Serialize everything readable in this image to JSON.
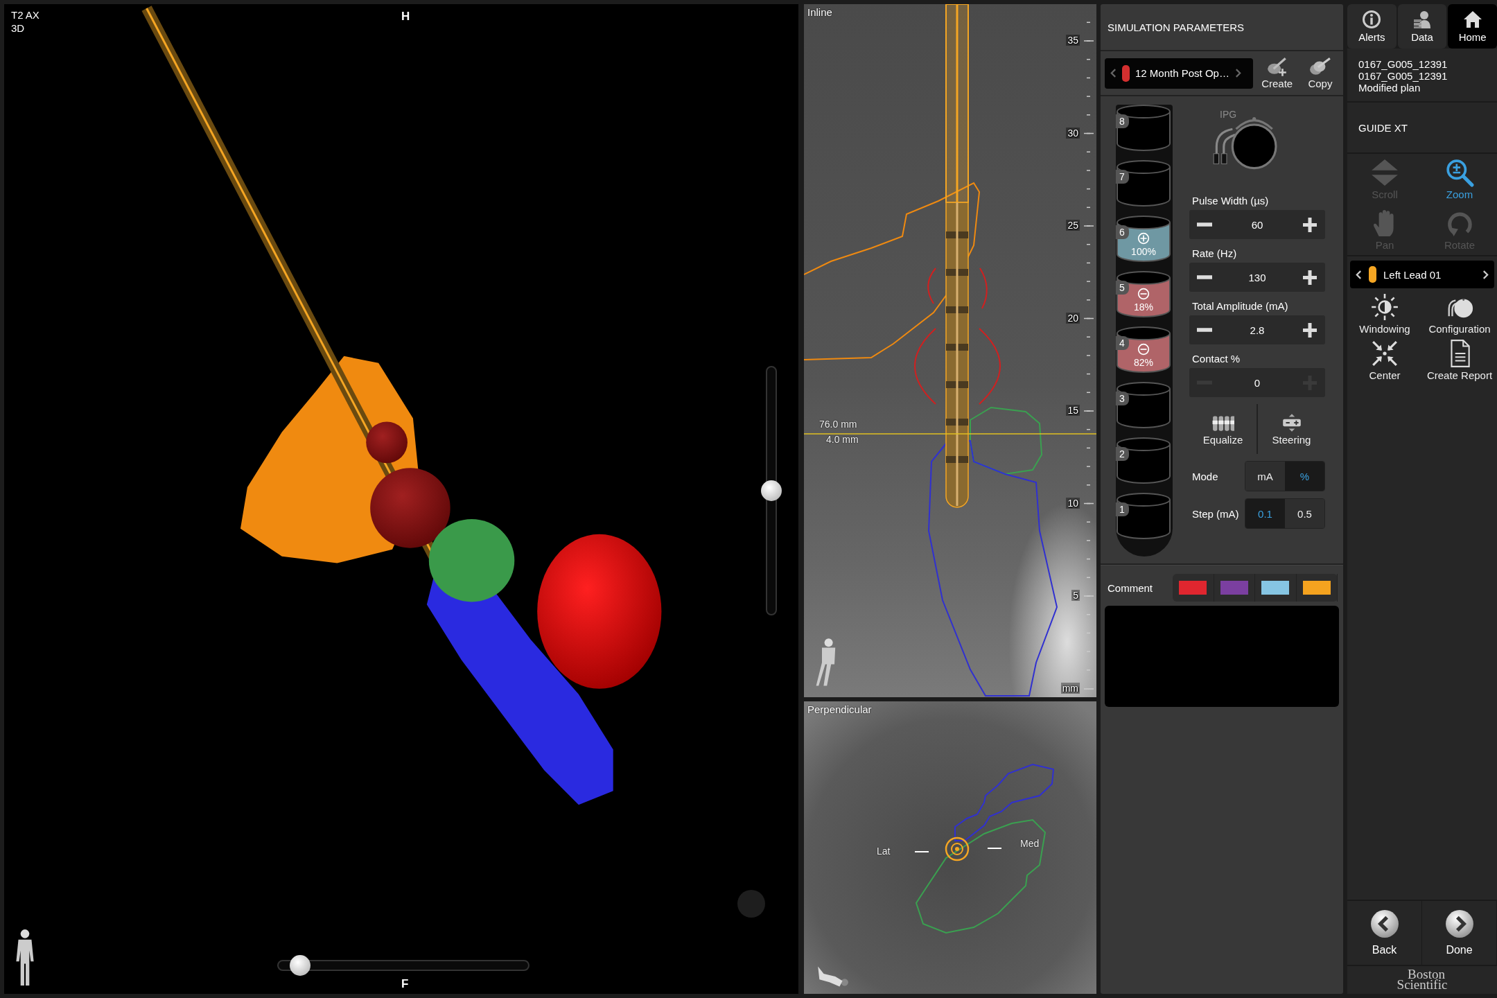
{
  "view_3d": {
    "series": "T2 AX",
    "mode": "3D",
    "top_marker": "H",
    "bottom_marker": "F",
    "vertical_slider": {
      "level": 0.5
    },
    "horizontal_slider": {
      "level": 0.08
    }
  },
  "inline_view": {
    "title": "Inline",
    "measurements": [
      "76.0 mm",
      "4.0 mm"
    ],
    "ruler": {
      "labels": [
        "35",
        "30",
        "25",
        "20",
        "15",
        "10",
        "5"
      ],
      "unit": "mm"
    }
  },
  "perpendicular_view": {
    "title": "Perpendicular",
    "left_label": "Lat",
    "right_label": "Med"
  },
  "simulation": {
    "title": "SIMULATION PARAMETERS",
    "program": {
      "name": "12 Month Post Op…",
      "color": "#d32f2f"
    },
    "actions": [
      {
        "label": "Create",
        "kind": "create"
      },
      {
        "label": "Copy",
        "kind": "copy"
      }
    ],
    "ipg_label": "IPG",
    "contacts": [
      {
        "number": "8",
        "kind": "off"
      },
      {
        "number": "7",
        "kind": "off"
      },
      {
        "number": "6",
        "kind": "anode",
        "percent": "100%"
      },
      {
        "number": "5",
        "kind": "cathode",
        "percent": "18%"
      },
      {
        "number": "4",
        "kind": "cathode",
        "percent": "82%"
      },
      {
        "number": "3",
        "kind": "off"
      },
      {
        "number": "2",
        "kind": "off"
      },
      {
        "number": "1",
        "kind": "off"
      }
    ],
    "parameters": [
      {
        "label": "Pulse Width (µs)",
        "value": "60",
        "disabled": false
      },
      {
        "label": "Rate (Hz)",
        "value": "130",
        "disabled": false
      },
      {
        "label": "Total Amplitude (mA)",
        "value": "2.8",
        "disabled": false
      },
      {
        "label": "Contact %",
        "value": "0",
        "disabled": true
      }
    ],
    "tools": [
      {
        "label": "Equalize",
        "kind": "equalize"
      },
      {
        "label": "Steering",
        "kind": "steering"
      }
    ],
    "mode": {
      "label": "Mode",
      "options": [
        {
          "label": "mA",
          "selected": false
        },
        {
          "label": "%",
          "selected": true
        }
      ]
    },
    "step": {
      "label": "Step (mA)",
      "options": [
        {
          "label": "0.1",
          "selected": true
        },
        {
          "label": "0.5",
          "selected": false
        }
      ]
    },
    "comment": {
      "label": "Comment",
      "colors": [
        {
          "color": "#e0262f"
        },
        {
          "color": "#7b3fa0"
        },
        {
          "color": "#86c5e3"
        },
        {
          "color": "#f5a31f"
        }
      ]
    }
  },
  "sidebar": {
    "nav": [
      {
        "label": "Alerts",
        "kind": "alerts",
        "selected": false
      },
      {
        "label": "Data",
        "kind": "data",
        "selected": false
      },
      {
        "label": "Home",
        "kind": "home",
        "selected": true
      }
    ],
    "patient": [
      "0167_G005_12391",
      "0167_G005_12391",
      "Modified plan"
    ],
    "device": "GUIDE XT",
    "view_tools": [
      {
        "label": "Scroll",
        "kind": "scroll",
        "selected": false,
        "disabled": true
      },
      {
        "label": "Zoom",
        "kind": "zoom",
        "selected": true,
        "disabled": false
      },
      {
        "label": "Pan",
        "kind": "pan",
        "selected": false,
        "disabled": true
      },
      {
        "label": "Rotate",
        "kind": "rotate",
        "selected": false,
        "disabled": true
      }
    ],
    "lead": {
      "name": "Left Lead 01",
      "color": "#f5a623"
    },
    "actions": [
      {
        "label": "Windowing",
        "kind": "windowing"
      },
      {
        "label": "Configuration",
        "kind": "configuration"
      },
      {
        "label": "Center",
        "kind": "center"
      },
      {
        "label": "Create Report",
        "kind": "report"
      }
    ],
    "footer": [
      {
        "label": "Back",
        "kind": "back"
      },
      {
        "label": "Done",
        "kind": "done"
      }
    ],
    "logo": [
      "Boston",
      "Scientific"
    ]
  }
}
